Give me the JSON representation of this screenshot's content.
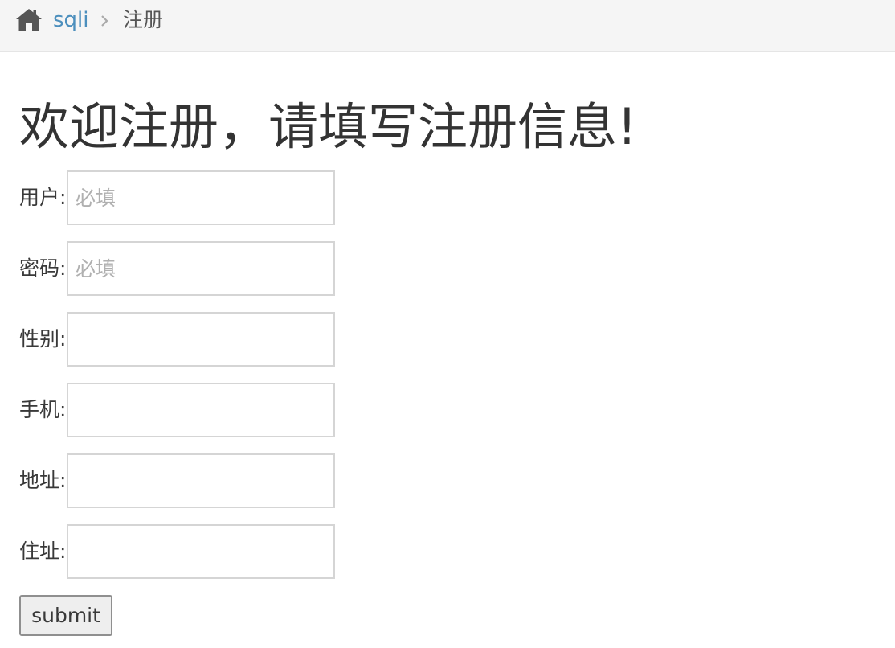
{
  "breadcrumb": {
    "home_icon": "home-icon",
    "link": "sqli",
    "separator_icon": "chevron-right-icon",
    "current": "注册"
  },
  "page_title": "欢迎注册，请填写注册信息!",
  "form": {
    "fields": [
      {
        "label": "用户:",
        "value": "",
        "placeholder": "必填"
      },
      {
        "label": "密码:",
        "value": "",
        "placeholder": "必填"
      },
      {
        "label": "性别:",
        "value": "",
        "placeholder": ""
      },
      {
        "label": "手机:",
        "value": "",
        "placeholder": ""
      },
      {
        "label": "地址:",
        "value": "",
        "placeholder": ""
      },
      {
        "label": "住址:",
        "value": "",
        "placeholder": ""
      }
    ],
    "submit_label": "submit"
  },
  "colors": {
    "breadcrumb_bg": "#f5f5f5",
    "link": "#4c8fbd",
    "text": "#393939",
    "input_border": "#d5d5d5",
    "placeholder": "#b0b0b0"
  }
}
